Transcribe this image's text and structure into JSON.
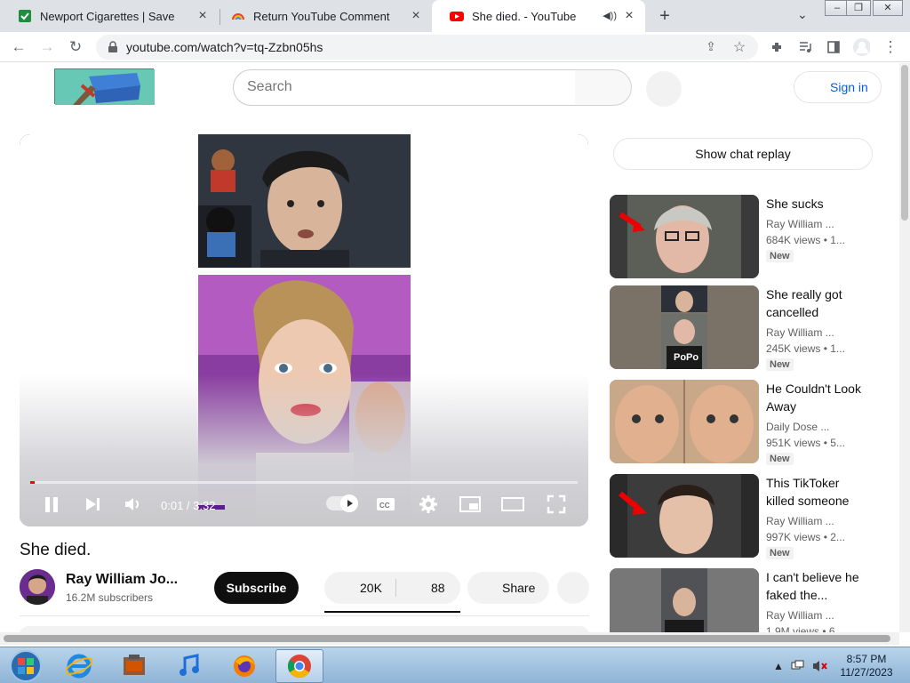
{
  "browser": {
    "tabs": [
      {
        "label": "Newport Cigarettes | Save in-sto"
      },
      {
        "label": "Return YouTube Comment Userna"
      },
      {
        "label": "She died. - YouTube"
      }
    ],
    "url": "youtube.com/watch?v=tq-Zzbn05hs"
  },
  "header": {
    "search_placeholder": "Search",
    "signin_label": "Sign in"
  },
  "player": {
    "time_current": "0:01",
    "time_total": "3:32",
    "progress_fraction": 0.008
  },
  "video": {
    "title": "She died.",
    "channel": "Ray William Jo...",
    "subscribers": "16.2M subscribers",
    "subscribe_label": "Subscribe",
    "likes": "20K",
    "dislikes": "88",
    "share_label": "Share"
  },
  "sidebar": {
    "chat_replay_label": "Show chat replay",
    "recommendations": [
      {
        "title": "She sucks",
        "channel": "Ray William ...",
        "views": "684K views",
        "age": "• 1...",
        "badge": "New"
      },
      {
        "title": "She really got cancelled",
        "channel": "Ray William ...",
        "views": "245K views",
        "age": "• 1...",
        "badge": "New"
      },
      {
        "title": "He Couldn't Look Away",
        "channel": "Daily Dose ...",
        "views": "951K views",
        "age": "• 5...",
        "badge": "New"
      },
      {
        "title": "This TikToker killed someone",
        "channel": "Ray William ...",
        "views": "997K views",
        "age": "• 2...",
        "badge": "New"
      },
      {
        "title": "I can't believe he faked the...",
        "channel": "Ray William ...",
        "views": "1.9M views",
        "age": "• 6..."
      }
    ],
    "thumb_text": "PoPo"
  },
  "taskbar": {
    "time": "8:57 PM",
    "date": "11/27/2023"
  },
  "colors": {
    "accent": "#065fd4",
    "progress": "#ff0000"
  }
}
